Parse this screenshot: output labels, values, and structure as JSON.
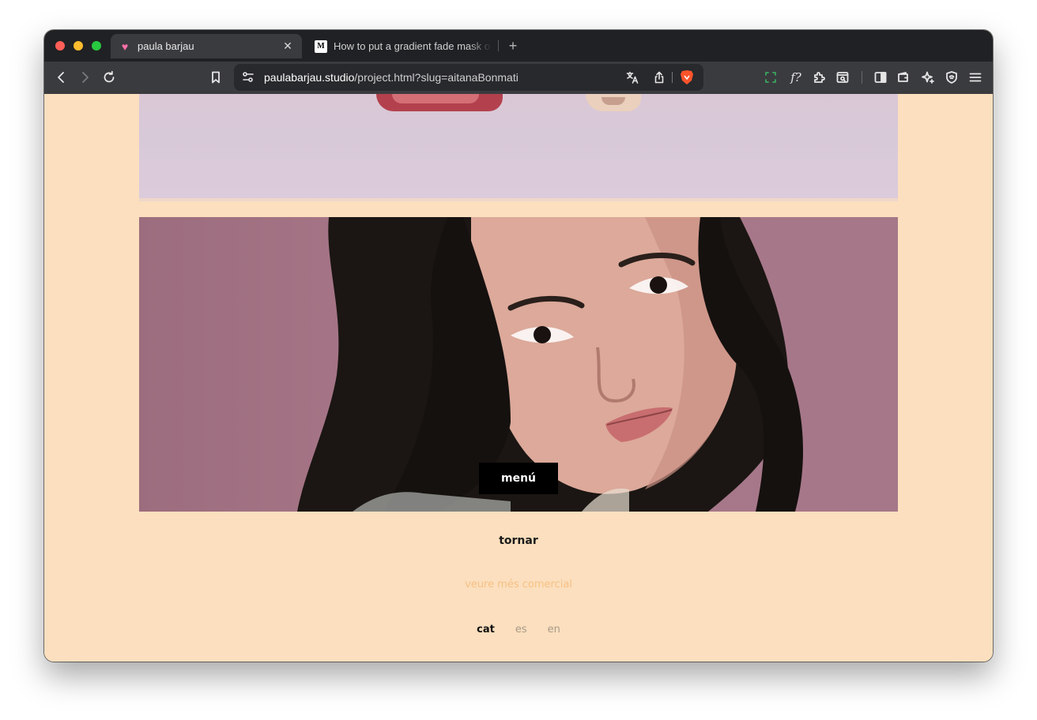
{
  "browser": {
    "tabs": [
      {
        "title": "paula barjau",
        "icon": "heart-favicon",
        "active": true
      },
      {
        "title": "How to put a gradient fade mask on",
        "icon": "medium-favicon",
        "active": false
      }
    ],
    "url": {
      "host": "paulabarjau.studio",
      "path": "/project.html?slug=aitanaBonmati"
    },
    "toolbar_icons": [
      "back-icon",
      "forward-icon",
      "reload-icon",
      "bookmark-icon",
      "site-settings-icon",
      "translate-icon",
      "share-icon",
      "brave-shields-icon",
      "screenshot-icon",
      "font-icon",
      "extensions-icon",
      "search-page-icon",
      "sidebar-icon",
      "wallet-icon",
      "leo-ai-icon",
      "vpn-icon",
      "menu-icon"
    ]
  },
  "page": {
    "menu_label": "menú",
    "back_label": "tornar",
    "more_label": "veure més comercial",
    "languages": [
      {
        "code": "cat",
        "active": true
      },
      {
        "code": "es",
        "active": false
      },
      {
        "code": "en",
        "active": false
      }
    ],
    "colors": {
      "background": "#fbdfbe",
      "menu_button": "#000000",
      "accent_link": "#f7c083"
    }
  }
}
